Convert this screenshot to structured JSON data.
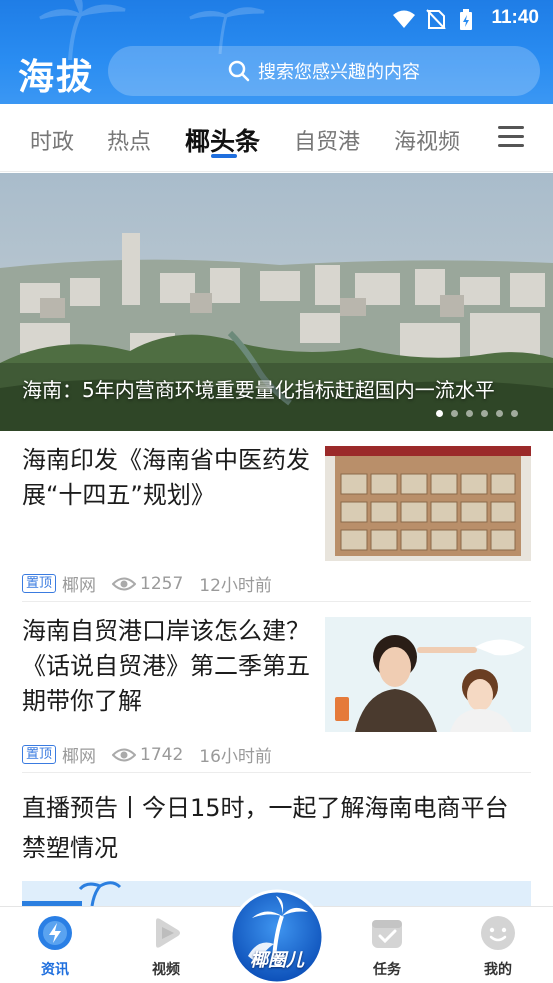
{
  "status_bar": {
    "time": "11:40"
  },
  "header": {
    "logo": "海拔",
    "search_placeholder": "搜索您感兴趣的内容"
  },
  "tabs": [
    {
      "label": "时政"
    },
    {
      "label": "热点"
    },
    {
      "label": "椰头条",
      "active": true
    },
    {
      "label": "自贸港"
    },
    {
      "label": "海视频"
    }
  ],
  "banner": {
    "caption": "海南：5年内营商环境重要量化指标赶超国内一流水平",
    "dot_count": 6,
    "active_dot": 0
  },
  "news": [
    {
      "title": "海南印发《海南省中医药发展“十四五”规划》",
      "tag": "置顶",
      "source": "椰网",
      "views": "1257",
      "time": "12小时前"
    },
    {
      "title": "海南自贸港口岸该怎么建？《话说自贸港》第二季第五期带你了解",
      "tag": "置顶",
      "source": "椰网",
      "views": "1742",
      "time": "16小时前"
    },
    {
      "title": "直播预告丨今日15时，一起了解海南电商平台禁塑情况"
    }
  ],
  "bottom_nav": {
    "items": [
      {
        "label": "资讯",
        "active": true
      },
      {
        "label": "视频"
      },
      {
        "label": "任务"
      },
      {
        "label": "我的"
      }
    ],
    "center_label": "椰圈儿"
  },
  "colors": {
    "primary": "#1f7de6",
    "active_tab": "#1f6fde"
  }
}
